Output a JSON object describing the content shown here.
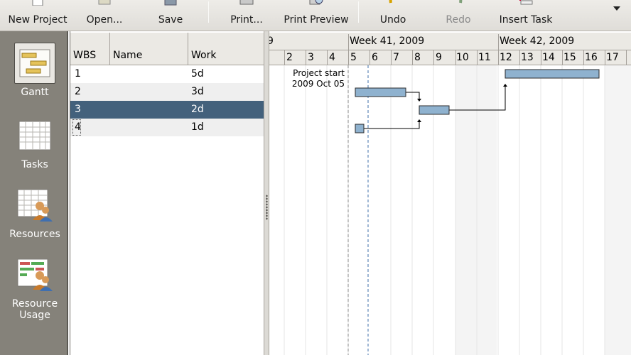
{
  "toolbar": {
    "new_project": "New Project",
    "open": "Open...",
    "save": "Save",
    "print": "Print...",
    "print_preview": "Print Preview",
    "undo": "Undo",
    "redo": "Redo",
    "insert_task": "Insert Task"
  },
  "sidebar": {
    "items": [
      {
        "label": "Gantt",
        "icon": "gantt-view-icon"
      },
      {
        "label": "Tasks",
        "icon": "tasks-view-icon"
      },
      {
        "label": "Resources",
        "icon": "resources-view-icon"
      },
      {
        "label": "Resource Usage",
        "icon": "resource-usage-view-icon"
      }
    ],
    "active": "Gantt"
  },
  "table": {
    "columns": [
      "WBS",
      "Name",
      "Work"
    ],
    "rows": [
      {
        "wbs": "1",
        "name": "",
        "work": "5d"
      },
      {
        "wbs": "2",
        "name": "",
        "work": "3d"
      },
      {
        "wbs": "3",
        "name": "",
        "work": "2d"
      },
      {
        "wbs": "4",
        "name": "",
        "work": "1d"
      }
    ],
    "selected_row": 3
  },
  "gantt": {
    "weeks": [
      "Week 41, 2009",
      "Week 42, 2009"
    ],
    "partial_first_label": "9",
    "days": [
      "2",
      "3",
      "4",
      "5",
      "6",
      "7",
      "8",
      "9",
      "10",
      "11",
      "12",
      "13",
      "14",
      "15",
      "16",
      "17"
    ],
    "project_start_label": "Project start",
    "project_start_date": "2009 Oct 05"
  },
  "colors": {
    "bar_fill": "#8fb2cf",
    "selection": "#43617c",
    "sidebar": "#85827a"
  }
}
